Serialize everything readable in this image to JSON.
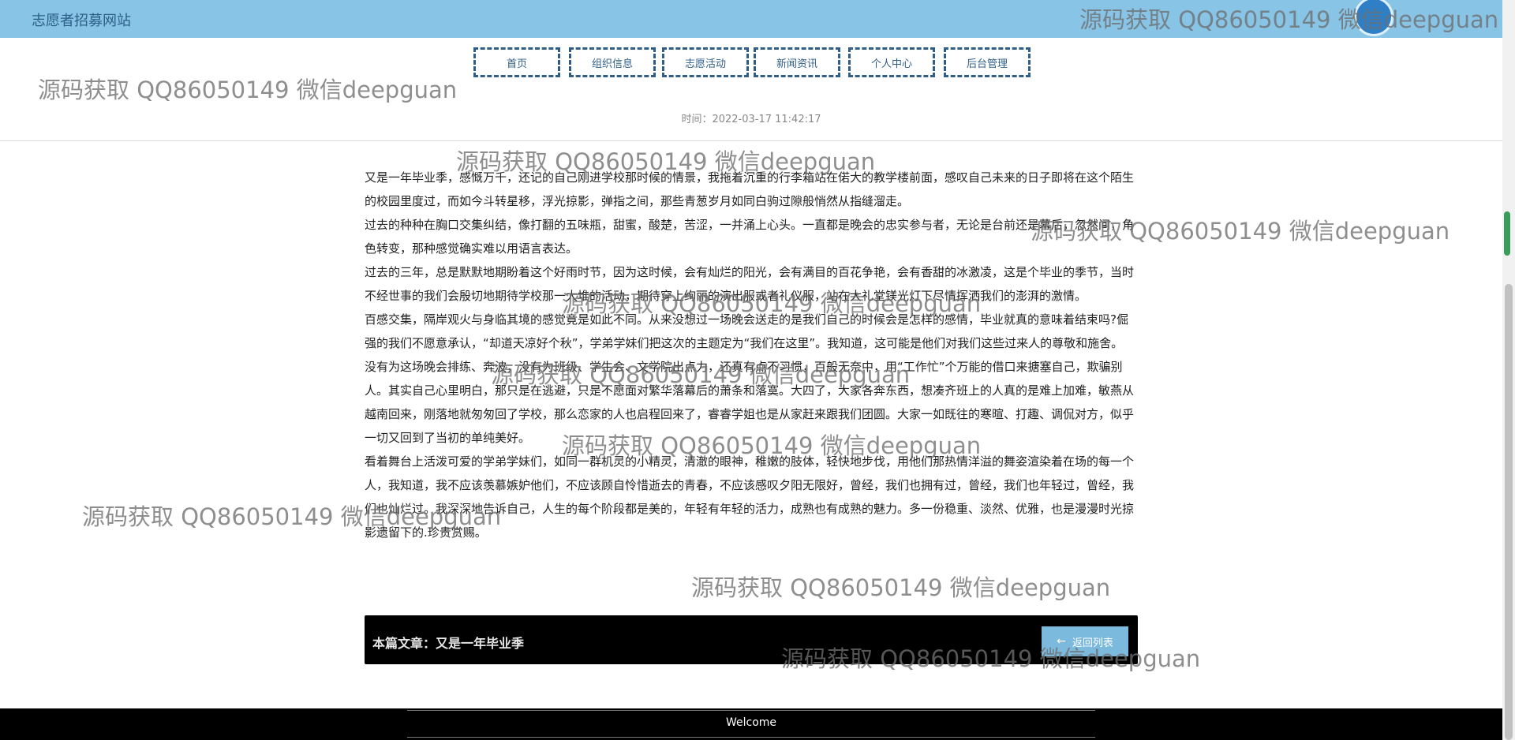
{
  "header": {
    "site_title": "志愿者招募网站"
  },
  "nav": {
    "items": [
      {
        "label": "首页"
      },
      {
        "label": "组织信息"
      },
      {
        "label": "志愿活动"
      },
      {
        "label": "新闻资讯"
      },
      {
        "label": "个人中心"
      },
      {
        "label": "后台管理"
      }
    ]
  },
  "article": {
    "time_text": "时间：2022-03-17 11:42:17",
    "paragraphs": [
      "又是一年毕业季，感慨万千，还记的自己刚进学校那时候的情景，我拖着沉重的行李箱站在偌大的教学楼前面，感叹自己未来的日子即将在这个陌生的校园里度过，而如今斗转星移，浮光掠影，弹指之间，那些青葱岁月如同白驹过隙般悄然从指缝溜走。",
      "过去的种种在胸口交集纠结，像打翻的五味瓶，甜蜜，酸楚，苦涩，一并涌上心头。一直都是晚会的忠实参与者，无论是台前还是幕后，忽然间，角色转变，那种感觉确实难以用语言表达。",
      "过去的三年，总是默默地期盼着这个好雨时节，因为这时候，会有灿烂的阳光，会有满目的百花争艳，会有香甜的冰激凌，这是个毕业的季节，当时不经世事的我们会殷切地期待学校那一大堆的活动，期待穿上绚丽的演出服或者礼仪服，站在大礼堂镁光灯下尽情挥洒我们的澎湃的激情。",
      "百感交集，隔岸观火与身临其境的感觉竟是如此不同。从来没想过一场晚会送走的是我们自己的时候会是怎样的感情，毕业就真的意味着结束吗?倔强的我们不愿意承认，“却道天凉好个秋”，学弟学妹们把这次的主题定为“我们在这里”。我知道，这可能是他们对我们这些过来人的尊敬和施舍。",
      "没有为这场晚会排练、奔波，没有为班级、学生会、文学院出点力，还真有点不习惯，百般无奈中，用“工作忙”个万能的借口来搪塞自己，欺骗别人。其实自己心里明白，那只是在逃避，只是不愿面对繁华落幕后的萧条和落寞。大四了，大家各奔东西，想凑齐班上的人真的是难上加难，敏燕从越南回来，刚落地就匆匆回了学校，那么恋家的人也启程回来了，睿睿学姐也是从家赶来跟我们团圆。大家一如既往的寒暄、打趣、调侃对方，似乎一切又回到了当初的单纯美好。",
      "看着舞台上活泼可爱的学弟学妹们，如同一群机灵的小精灵，清澈的眼神，稚嫩的肢体，轻快地步伐，用他们那热情洋溢的舞姿渲染着在场的每一个人，我知道，我不应该羡慕嫉妒他们，不应该顾自怜惜逝去的青春，不应该感叹夕阳无限好，曾经，我们也拥有过，曾经，我们也年轻过，曾经，我们也灿烂过。我深深地告诉自己，人生的每个阶段都是美的，年轻有年轻的活力，成熟也有成熟的魅力。多一份稳重、淡然、优雅，也是漫漫时光掠影遗留下的.珍贵赏赐。"
    ],
    "footer_title": "本篇文章：又是一年毕业季",
    "back_label": "返回列表",
    "back_icon": "arrow-left-icon"
  },
  "footer": {
    "welcome": "Welcome"
  },
  "watermark": {
    "text": "源码获取 QQ86050149 微信deepguan"
  },
  "colors": {
    "topbar_bg": "#87c4e6",
    "nav_border": "#2f5e88",
    "article_footer_bg": "#000000",
    "back_button_bg": "#7bb9dd"
  }
}
